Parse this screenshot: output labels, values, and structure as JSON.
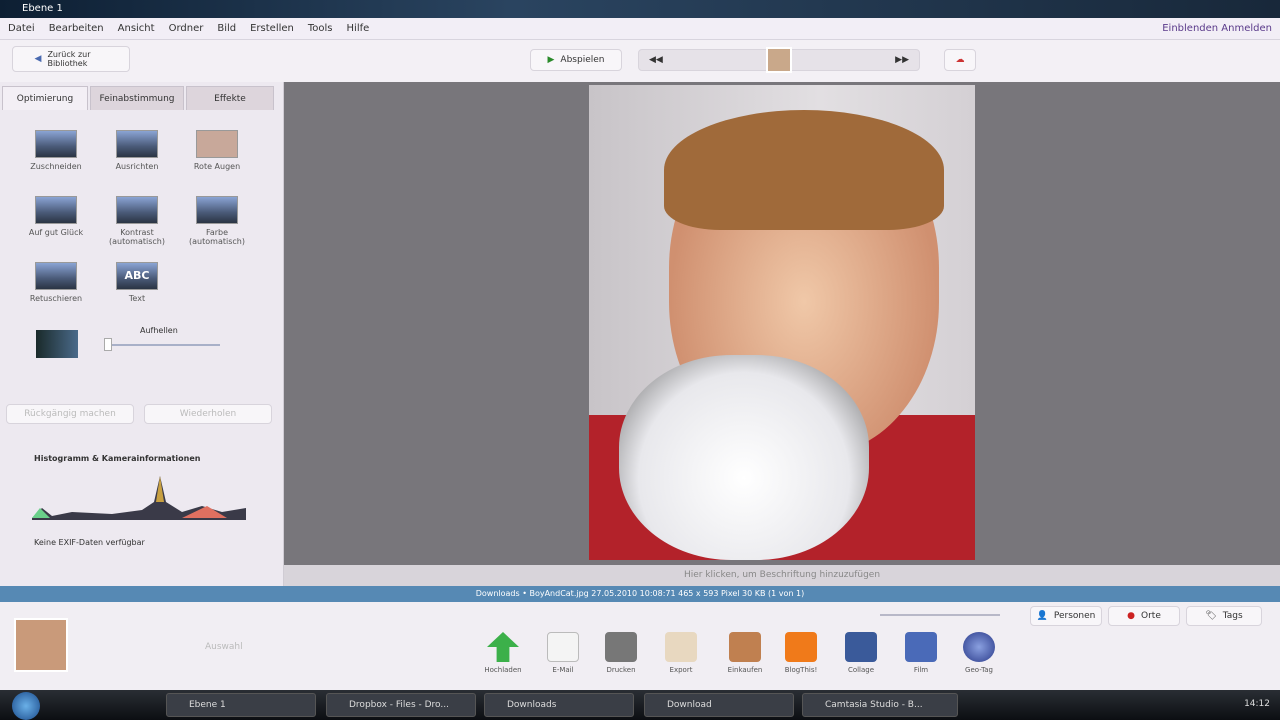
{
  "window": {
    "title": "Ebene 1"
  },
  "menu": {
    "items": [
      "Datei",
      "Bearbeiten",
      "Ansicht",
      "Ordner",
      "Bild",
      "Erstellen",
      "Tools",
      "Hilfe"
    ],
    "signin": "Einblenden Anmelden"
  },
  "toolbar": {
    "back": "Zurück zur Bibliothek",
    "play": "Abspielen"
  },
  "tabs": [
    "Optimierung",
    "Feinabstimmung",
    "Effekte"
  ],
  "tools": [
    "Zuschneiden",
    "Ausrichten",
    "Rote Augen",
    "Auf gut Glück",
    "Kontrast (automatisch)",
    "Farbe (automatisch)",
    "Retuschieren",
    "Text"
  ],
  "fill_light": {
    "label": "Aufhellen",
    "value": 0
  },
  "undo": "Rückgängig machen",
  "redo": "Wiederholen",
  "histogram": {
    "title": "Histogramm & Kamerainformationen",
    "exif": "Keine EXIF-Daten verfügbar"
  },
  "caption_placeholder": "Hier klicken, um Beschriftung hinzuzufügen",
  "status": "Downloads • BoyAndCat.jpg 27.05.2010 10:08:71 465 x 593 Pixel 30 KB   (1 von 1)",
  "tray": {
    "selection": "Auswahl",
    "right_buttons": [
      "Personen",
      "Orte",
      "Tags"
    ],
    "actions": [
      "Hochladen",
      "E-Mail",
      "Drucken",
      "Export",
      "Einkaufen",
      "BlogThis!",
      "Collage",
      "Film",
      "Geo-Tag"
    ]
  },
  "taskbar": {
    "items": [
      "Ebene 1",
      "Dropbox - Files - Dro...",
      "Downloads",
      "Download",
      "Camtasia Studio - B..."
    ],
    "time": "14:12"
  }
}
